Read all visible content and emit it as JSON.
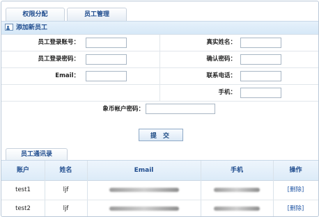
{
  "tabs": [
    "权限分配",
    "员工管理"
  ],
  "section": {
    "title": "添加新员工"
  },
  "form": {
    "left": [
      {
        "label": "员工登录账号：",
        "value": ""
      },
      {
        "label": "员工登录密码：",
        "value": ""
      },
      {
        "label": "Email：",
        "value": ""
      }
    ],
    "right": [
      {
        "label": "真实姓名：",
        "value": ""
      },
      {
        "label": "确认密码：",
        "value": ""
      },
      {
        "label": "联系电话：",
        "value": ""
      },
      {
        "label": "手机：",
        "value": ""
      }
    ],
    "center": {
      "label": "象币帐户密码：",
      "value": ""
    },
    "submit_label": "提 交"
  },
  "contacts": {
    "title": "员工通讯录",
    "headers": [
      "账户",
      "姓名",
      "Email",
      "手机",
      "操作"
    ],
    "rows": [
      {
        "account": "test1",
        "name": "ljf",
        "action": "[删除]"
      },
      {
        "account": "test2",
        "name": "ljf",
        "action": "[删除]"
      }
    ]
  }
}
